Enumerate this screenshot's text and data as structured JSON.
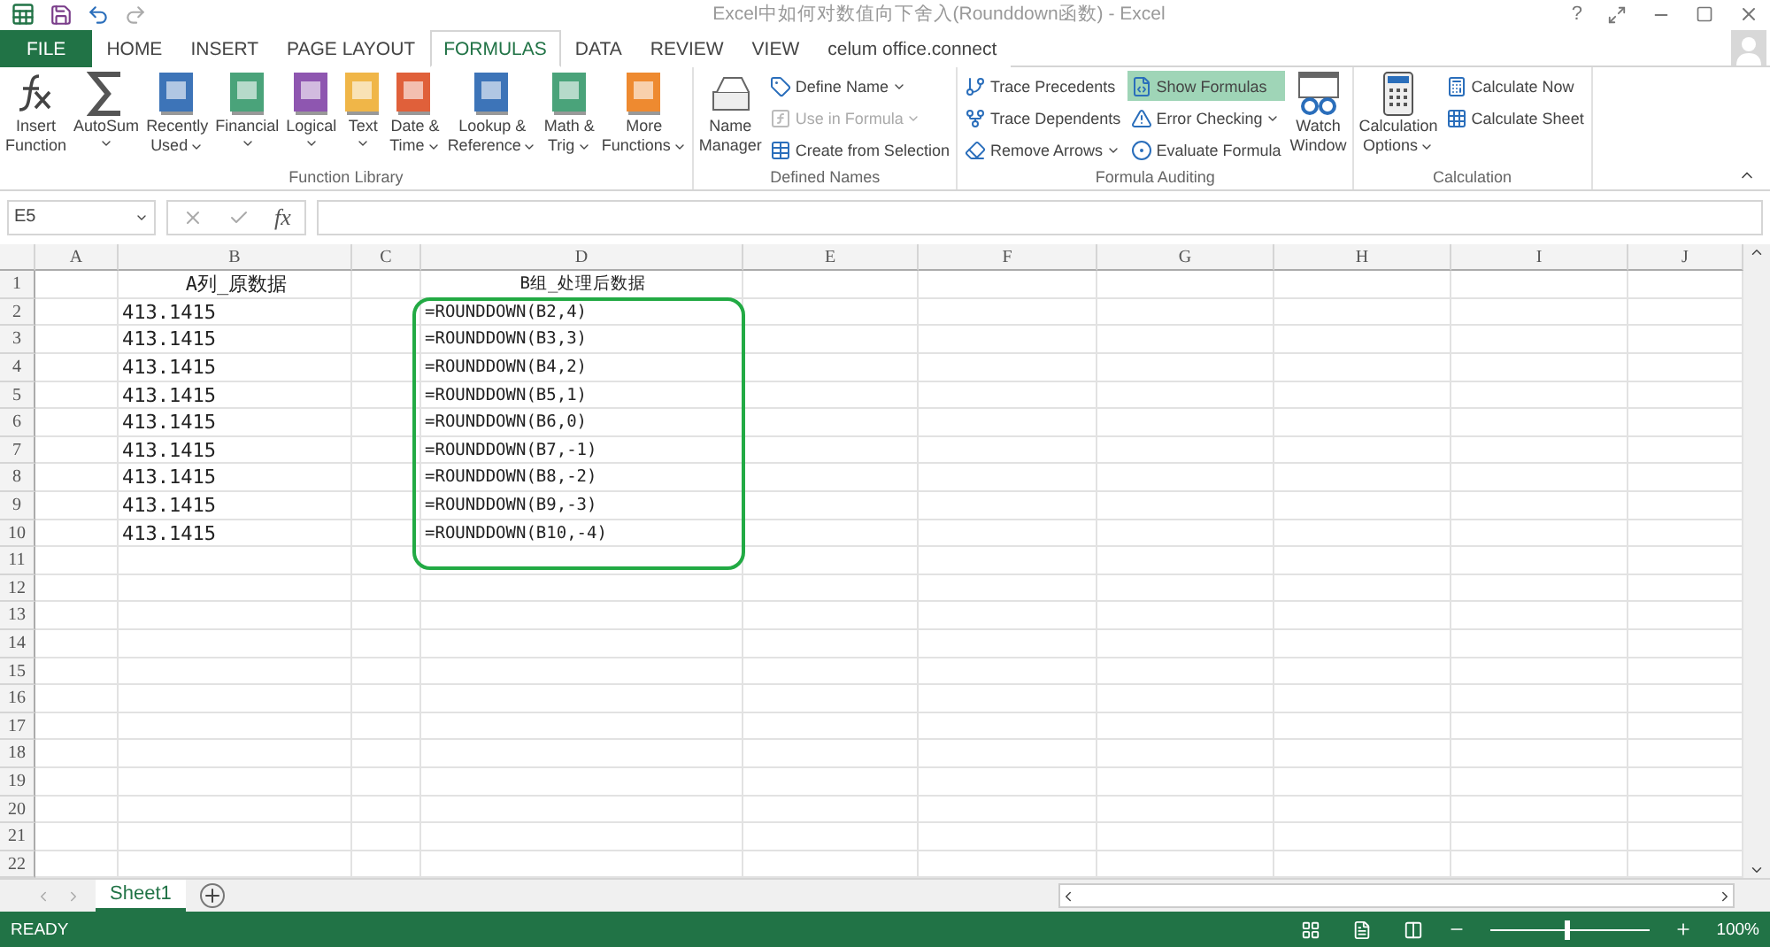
{
  "window": {
    "title": "Excel中如何对数值向下舍入(Rounddown函数) - Excel",
    "controls": [
      "?"
    ]
  },
  "tabs": [
    {
      "label": "FILE",
      "kind": "file",
      "selected": false
    },
    {
      "label": "HOME",
      "kind": "tab",
      "selected": false
    },
    {
      "label": "INSERT",
      "kind": "tab",
      "selected": false
    },
    {
      "label": "PAGE LAYOUT",
      "kind": "tab",
      "selected": false
    },
    {
      "label": "FORMULAS",
      "kind": "tab",
      "selected": true
    },
    {
      "label": "DATA",
      "kind": "tab",
      "selected": false
    },
    {
      "label": "REVIEW",
      "kind": "tab",
      "selected": false
    },
    {
      "label": "VIEW",
      "kind": "tab",
      "selected": false
    },
    {
      "label": "celum office.connect",
      "kind": "tab",
      "selected": false
    }
  ],
  "ribbon": [
    {
      "label": "Function Library",
      "large": [
        {
          "kind": "fx",
          "lines": [
            "Insert",
            "Function"
          ],
          "menu": false
        },
        {
          "kind": "sum",
          "lines": [
            "AutoSum"
          ],
          "menu": true
        },
        {
          "kind": "book",
          "color": "#3d74b8",
          "lines": [
            "Recently",
            "Used"
          ],
          "menu": true
        },
        {
          "kind": "book",
          "color": "#4aa37a",
          "lines": [
            "Financial"
          ],
          "menu": true
        },
        {
          "kind": "book",
          "color": "#8e56b0",
          "lines": [
            "Logical"
          ],
          "menu": true
        },
        {
          "kind": "book",
          "color": "#f0b648",
          "lines": [
            "Text"
          ],
          "menu": true
        },
        {
          "kind": "book",
          "color": "#e0603a",
          "lines": [
            "Date &",
            "Time"
          ],
          "menu": true
        },
        {
          "kind": "book",
          "color": "#3d74b8",
          "lines": [
            "Lookup &",
            "Reference"
          ],
          "menu": true
        },
        {
          "kind": "book",
          "color": "#4aa37a",
          "lines": [
            "Math &",
            "Trig"
          ],
          "menu": true
        },
        {
          "kind": "book",
          "color": "#ee8a30",
          "lines": [
            "More",
            "Functions"
          ],
          "menu": true
        }
      ]
    },
    {
      "label": "Defined Names",
      "large": [
        {
          "kind": "names",
          "lines": [
            "Name",
            "Manager"
          ],
          "menu": false
        }
      ],
      "small": [
        {
          "label": "Define Name",
          "menu": true,
          "disabled": false,
          "on": false
        },
        {
          "label": "Use in Formula",
          "menu": true,
          "disabled": true,
          "on": false
        },
        {
          "label": "Create from Selection",
          "menu": false,
          "disabled": false,
          "on": false
        }
      ]
    },
    {
      "label": "Formula Auditing",
      "small": [
        {
          "label": "Trace Precedents",
          "menu": false,
          "disabled": false,
          "on": false
        },
        {
          "label": "Trace Dependents",
          "menu": false,
          "disabled": false,
          "on": false
        },
        {
          "label": "Remove Arrows",
          "menu": true,
          "disabled": false,
          "on": false
        },
        {
          "label": "Show Formulas",
          "menu": false,
          "disabled": false,
          "on": true
        },
        {
          "label": "Error Checking",
          "menu": true,
          "disabled": false,
          "on": false
        },
        {
          "label": "Evaluate Formula",
          "menu": false,
          "disabled": false,
          "on": false
        }
      ],
      "after": [
        {
          "kind": "watch",
          "lines": [
            "Watch",
            "Window"
          ],
          "menu": false
        }
      ]
    },
    {
      "label": "Calculation",
      "large": [
        {
          "kind": "calc",
          "lines": [
            "Calculation",
            "Options"
          ],
          "menu": true
        }
      ],
      "small": [
        {
          "label": "Calculate Now",
          "menu": false,
          "disabled": false,
          "on": false
        },
        {
          "label": "Calculate Sheet",
          "menu": false,
          "disabled": false,
          "on": false
        }
      ]
    }
  ],
  "formula_bar": {
    "name_box": "E5",
    "fx": "fx"
  },
  "sheet": {
    "columns": [
      "A",
      "B",
      "C",
      "D",
      "E",
      "F",
      "G",
      "H",
      "I",
      "J"
    ],
    "rows": [
      {
        "num": "1",
        "cells": [
          "",
          "A列_原数据",
          "",
          "B组_处理后数据"
        ]
      },
      {
        "num": "2",
        "cells": [
          "",
          "413.1415",
          "",
          "=ROUNDDOWN(B2,4)"
        ]
      },
      {
        "num": "3",
        "cells": [
          "",
          "413.1415",
          "",
          "=ROUNDDOWN(B3,3)"
        ]
      },
      {
        "num": "4",
        "cells": [
          "",
          "413.1415",
          "",
          "=ROUNDDOWN(B4,2)"
        ]
      },
      {
        "num": "5",
        "cells": [
          "",
          "413.1415",
          "",
          "=ROUNDDOWN(B5,1)"
        ]
      },
      {
        "num": "6",
        "cells": [
          "",
          "413.1415",
          "",
          "=ROUNDDOWN(B6,0)"
        ]
      },
      {
        "num": "7",
        "cells": [
          "",
          "413.1415",
          "",
          "=ROUNDDOWN(B7,-1)"
        ]
      },
      {
        "num": "8",
        "cells": [
          "",
          "413.1415",
          "",
          "=ROUNDDOWN(B8,-2)"
        ]
      },
      {
        "num": "9",
        "cells": [
          "",
          "413.1415",
          "",
          "=ROUNDDOWN(B9,-3)"
        ]
      },
      {
        "num": "10",
        "cells": [
          "",
          "413.1415",
          "",
          "=ROUNDDOWN(B10,-4)"
        ]
      },
      {
        "num": "11",
        "cells": []
      },
      {
        "num": "12",
        "cells": []
      },
      {
        "num": "13",
        "cells": []
      },
      {
        "num": "14",
        "cells": []
      },
      {
        "num": "15",
        "cells": []
      },
      {
        "num": "16",
        "cells": []
      },
      {
        "num": "17",
        "cells": []
      },
      {
        "num": "18",
        "cells": []
      },
      {
        "num": "19",
        "cells": []
      },
      {
        "num": "20",
        "cells": []
      },
      {
        "num": "21",
        "cells": []
      },
      {
        "num": "22",
        "cells": []
      }
    ]
  },
  "sheet_tabs": [
    {
      "label": "Sheet1",
      "selected": true
    }
  ],
  "status_bar": {
    "text": "READY",
    "zoom": "100%",
    "level": 0.47
  }
}
